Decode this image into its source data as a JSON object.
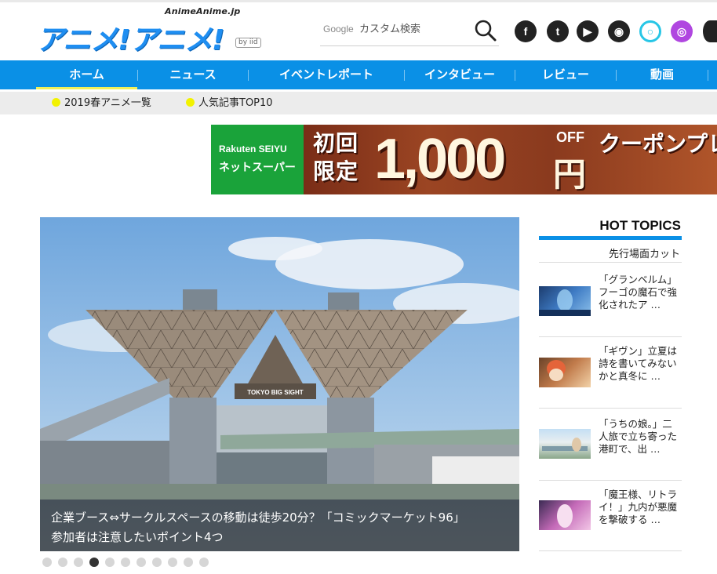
{
  "logo": {
    "tagline": "AnimeAnime.jp",
    "main": "アニメ!アニメ!",
    "byline": "by iid"
  },
  "search": {
    "brand": "Google",
    "placeholder": "カスタム検索"
  },
  "social": [
    {
      "icon": "facebook-icon",
      "glyph": "f"
    },
    {
      "icon": "twitter-icon",
      "glyph": "t"
    },
    {
      "icon": "youtube-icon",
      "glyph": "▶"
    },
    {
      "icon": "rss-icon",
      "glyph": "◉"
    },
    {
      "icon": "alexa-icon",
      "glyph": "○"
    },
    {
      "icon": "podcast-icon",
      "glyph": "◎"
    }
  ],
  "nav": {
    "items": [
      "ホーム",
      "ニュース",
      "イベントレポート",
      "インタビュー",
      "レビュー",
      "動画"
    ]
  },
  "subnav": {
    "items": [
      "2019春アニメ一覧",
      "人気記事TOP10"
    ]
  },
  "ad": {
    "brand": "Rakuten SEIYU",
    "brand_sub": "ネットスーパー",
    "first_time": "初回限定",
    "amount": "1,000",
    "off": "OFF",
    "yen": "円",
    "coupon": "クーポンプレゼント"
  },
  "hero": {
    "building_sign": "TOKYO BIG SIGHT",
    "caption_line1": "企業ブース⇔サークルスペースの移動は徒歩20分？「コミックマーケット96」",
    "caption_line2": "参加者は注意したいポイント4つ",
    "slide_count": 11,
    "active_slide": 4
  },
  "hot_topics": {
    "title": "HOT TOPICS",
    "tag": "先行場面カット",
    "items": [
      {
        "text": "「グランベルム」フーゴの魔石で強化されたア …"
      },
      {
        "text": "「ギヴン」立夏は詩を書いてみないかと真冬に …"
      },
      {
        "text": "「うちの娘。」二人旅で立ち寄った港町で、出 …"
      },
      {
        "text": "「魔王様、リトライ！」九内が悪魔を撃破する …"
      }
    ]
  },
  "colors": {
    "brand_blue": "#0a90e6",
    "nav_accent": "#f0f05a",
    "subnav_dot": "#f2f200",
    "ad_green": "#1aa33a"
  }
}
